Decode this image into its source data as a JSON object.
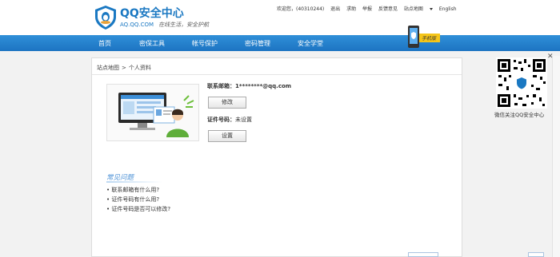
{
  "header": {
    "logo_title": "QQ安全中心",
    "logo_domain": "AQ.QQ.COM",
    "logo_slogan": "在线生活，安全护航",
    "welcome": "欢迎您，",
    "user_id": "(40310244)",
    "links": [
      "退出",
      "求助",
      "举报",
      "反馈意见"
    ],
    "sitemap": "站点地图",
    "language": "English"
  },
  "nav": {
    "items": [
      "首页",
      "密保工具",
      "帐号保护",
      "密码管理",
      "安全学堂"
    ],
    "badge_text": "手机版"
  },
  "breadcrumb": [
    "站点地图",
    "个人资料"
  ],
  "profile": {
    "email_label": "联系邮箱：",
    "email_value": "1********@qq.com",
    "modify_button": "修改",
    "id_label": "证件号码：",
    "id_value": "未设置",
    "set_button": "设置"
  },
  "faq": {
    "title": "常见问题",
    "items": [
      "• 联系邮箱有什么用?",
      "• 证件号码有什么用?",
      "• 证件号码是否可以修改?"
    ]
  },
  "qr": {
    "caption": "微信关注QQ安全中心"
  },
  "colors": {
    "nav_blue": "#1d74c2",
    "brand_blue": "#1a78c2",
    "accent_yellow": "#f5c518"
  }
}
